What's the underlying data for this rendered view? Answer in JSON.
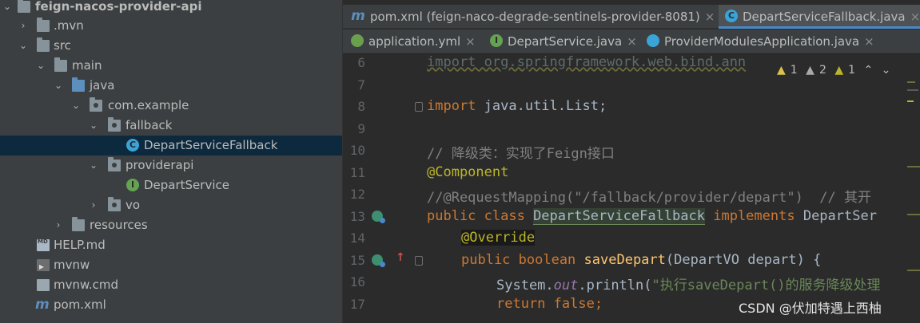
{
  "tree": {
    "items": [
      {
        "label": "feign-nacos-provider-api",
        "icon": "folder-icon",
        "bold": true
      },
      {
        "label": ".mvn",
        "icon": "folder-icon"
      },
      {
        "label": "src",
        "icon": "folder-icon"
      },
      {
        "label": "main",
        "icon": "folder-icon"
      },
      {
        "label": "java",
        "icon": "source-folder-icon"
      },
      {
        "label": "com.example",
        "icon": "package-icon"
      },
      {
        "label": "fallback",
        "icon": "package-icon"
      },
      {
        "label": "DepartServiceFallback",
        "icon": "class-icon",
        "badge": "C"
      },
      {
        "label": "providerapi",
        "icon": "package-icon"
      },
      {
        "label": "DepartService",
        "icon": "interface-icon",
        "badge": "I"
      },
      {
        "label": "vo",
        "icon": "package-icon"
      },
      {
        "label": "resources",
        "icon": "resources-folder-icon"
      },
      {
        "label": "HELP.md",
        "icon": "markdown-file-icon"
      },
      {
        "label": "mvnw",
        "icon": "terminal-file-icon"
      },
      {
        "label": "mvnw.cmd",
        "icon": "file-icon"
      },
      {
        "label": "pom.xml",
        "icon": "maven-icon",
        "glyph": "m"
      }
    ]
  },
  "tabs": {
    "row1": [
      {
        "label": "pom.xml (feign-naco-degrade-sentinels-provider-8081)",
        "icon": "maven-icon",
        "glyph": "m",
        "close": "×"
      },
      {
        "label": "DepartServiceFallback.java",
        "icon": "class-icon",
        "glyph": "C",
        "close": "×",
        "active": true
      }
    ],
    "row2": [
      {
        "label": "application.yml",
        "icon": "yaml-icon",
        "close": "×"
      },
      {
        "label": "DepartService.java",
        "icon": "interface-icon",
        "glyph": "I",
        "close": "×"
      },
      {
        "label": "ProviderModulesApplication.java",
        "icon": "application-icon",
        "close": "×"
      }
    ]
  },
  "editor": {
    "line_numbers": [
      "6",
      "7",
      "8",
      "9",
      "10",
      "11",
      "12",
      "13",
      "14",
      "15",
      "16",
      "17"
    ],
    "lines": {
      "l6": "import org.springframework.web.bind.ann",
      "l8_kw": "import",
      "l8_rest": " java.util.List;",
      "l10": "// 降级类：实现了Feign接口",
      "l11": "@Component",
      "l12": "//@RequestMapping(\"/fallback/provider/depart\")  // 其开",
      "l13_kw": "public class ",
      "l13_cls": "DepartServiceFallback",
      "l13_kw2": " implements ",
      "l13_iface": "DepartSer",
      "l14": "@Override",
      "l15_kw": "public boolean ",
      "l15_meth": "saveDepart",
      "l15_rest": "(DepartVO depart) {",
      "l16_sys": "System.",
      "l16_out": "out",
      "l16_print": ".println(",
      "l16_str": "\"执行saveDepart()的服务降级处理",
      "l17": "return false;"
    },
    "inspections": {
      "warn1": "1",
      "warn2": "2",
      "warn3": "1",
      "up": "⌃",
      "down": "⌄"
    }
  },
  "watermark": "CSDN @伏加特遇上西柚",
  "colors": {
    "background": "#2b2b2b",
    "panel": "#3c3f41",
    "selection": "#0d293e",
    "accent": "#4a88c7",
    "keyword": "#cc7832",
    "annotation": "#bbb529",
    "string": "#6a8759",
    "method": "#ffc66d",
    "field": "#9876aa"
  }
}
